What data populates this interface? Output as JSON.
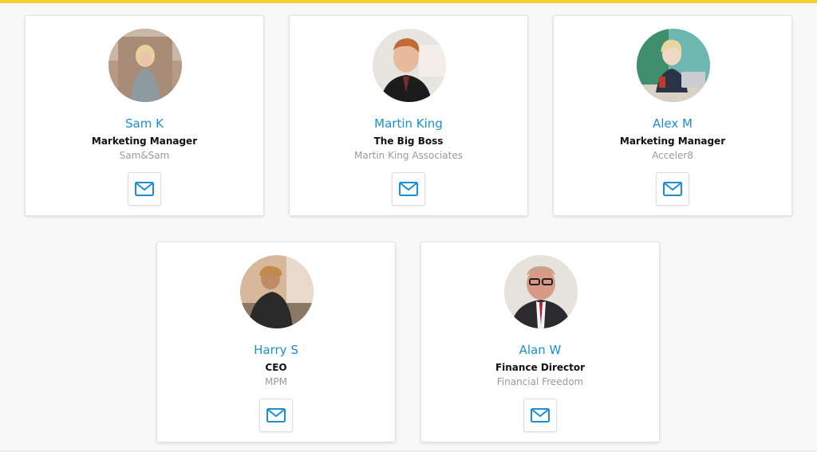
{
  "colors": {
    "accent_bar": "#f4d12e",
    "name_link": "#1b8fcf",
    "mail_icon": "#1b8fcf",
    "company_text": "#9a9a9a"
  },
  "team": [
    {
      "name": "Sam K",
      "title": "Marketing Manager",
      "company": "Sam&Sam",
      "icon": "mail-icon"
    },
    {
      "name": "Martin King",
      "title": "The Big Boss",
      "company": "Martin King Associates",
      "icon": "mail-icon"
    },
    {
      "name": "Alex M",
      "title": "Marketing Manager",
      "company": "Acceler8",
      "icon": "mail-icon"
    },
    {
      "name": "Harry S",
      "title": "CEO",
      "company": "MPM",
      "icon": "mail-icon"
    },
    {
      "name": "Alan W",
      "title": "Finance Director",
      "company": "Financial Freedom",
      "icon": "mail-icon"
    }
  ]
}
